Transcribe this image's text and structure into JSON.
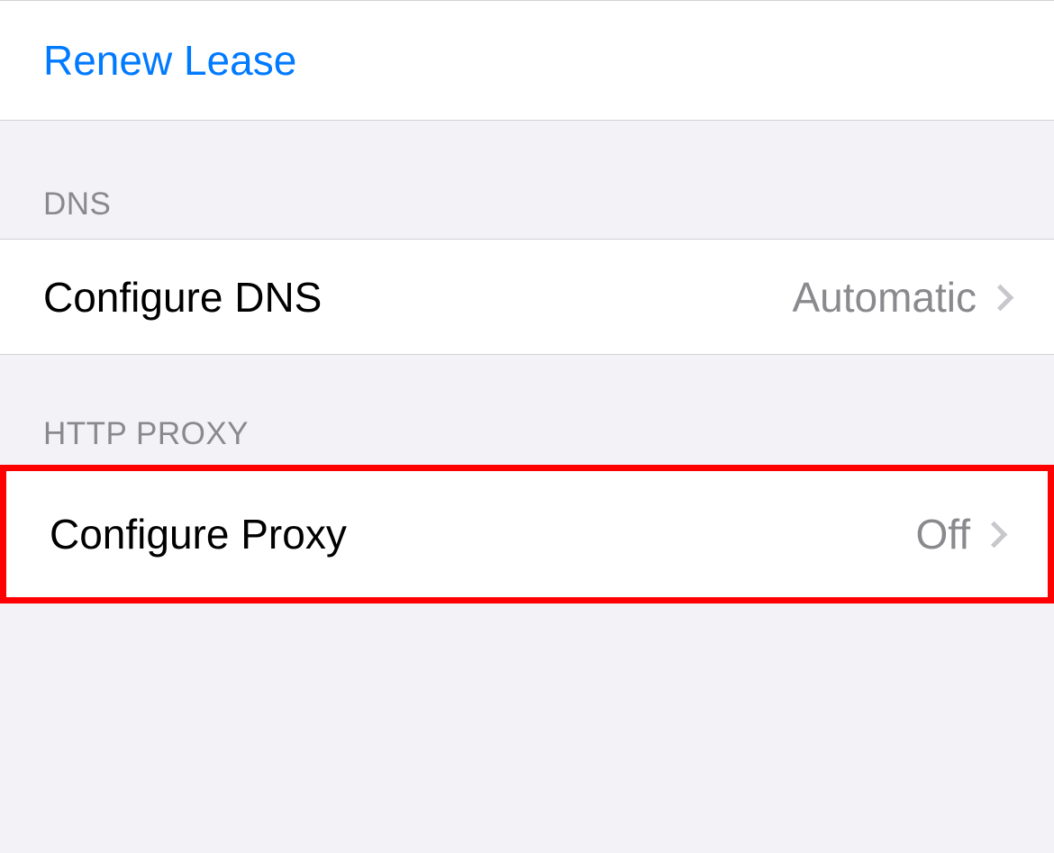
{
  "lease": {
    "renew_label": "Renew Lease"
  },
  "dns": {
    "header": "DNS",
    "configure_label": "Configure DNS",
    "configure_value": "Automatic"
  },
  "proxy": {
    "header": "HTTP PROXY",
    "configure_label": "Configure Proxy",
    "configure_value": "Off"
  }
}
